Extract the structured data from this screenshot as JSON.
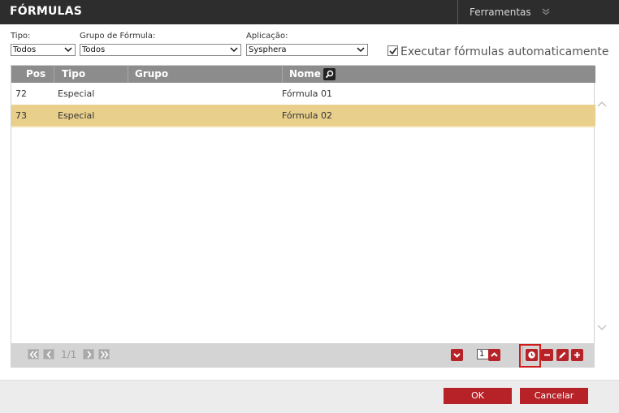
{
  "header": {
    "title": "FÓRMULAS",
    "tools_label": "Ferramentas"
  },
  "filters": {
    "tipo": {
      "label": "Tipo:",
      "value": "Todos"
    },
    "grupo": {
      "label": "Grupo de Fórmula:",
      "value": "Todos"
    },
    "aplicacao": {
      "label": "Aplicação:",
      "value": "Sysphera"
    },
    "auto": {
      "label": "Executar fórmulas automaticamente",
      "checked": true
    }
  },
  "table": {
    "columns": [
      "Pos",
      "Tipo",
      "Grupo",
      "Nome"
    ],
    "rows": [
      {
        "pos": "72",
        "tipo": "Especial",
        "grupo": "",
        "nome": "Fórmula 01",
        "selected": false
      },
      {
        "pos": "73",
        "tipo": "Especial",
        "grupo": "",
        "nome": "Fórmula 02",
        "selected": true
      }
    ]
  },
  "pager": {
    "info": "1/1",
    "page_input": "1"
  },
  "footer": {
    "ok_label": "OK",
    "cancel_label": "Cancelar"
  },
  "colors": {
    "accent": "#b62228",
    "selected_row": "#e8cf8c",
    "header_bg": "#2d2d2d",
    "grid_header": "#8c8c8c"
  }
}
